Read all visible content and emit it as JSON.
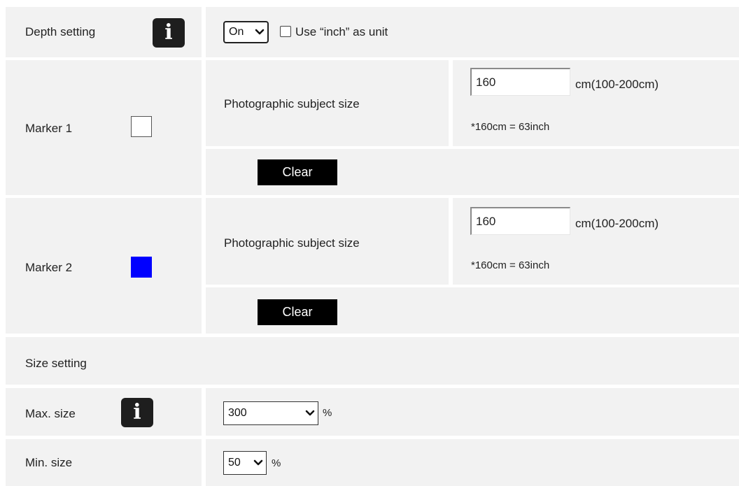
{
  "depth": {
    "label": "Depth setting",
    "info": "i",
    "select_value": "On",
    "inch_checkbox_label": "Use “inch” as unit"
  },
  "markers": [
    {
      "label": "Marker 1",
      "swatch_color": "#ffffff",
      "subject_label": "Photographic subject size",
      "size_value": "160",
      "unit_label": "cm(100-200cm)",
      "conversion_note": "*160cm = 63inch",
      "clear_label": "Clear"
    },
    {
      "label": "Marker 2",
      "swatch_color": "#0000ff",
      "subject_label": "Photographic subject size",
      "size_value": "160",
      "unit_label": "cm(100-200cm)",
      "conversion_note": "*160cm = 63inch",
      "clear_label": "Clear"
    }
  ],
  "size": {
    "section_label": "Size setting",
    "max_label": "Max. size",
    "max_info": "i",
    "max_value": "300",
    "max_unit": "%",
    "min_label": "Min. size",
    "min_value": "50",
    "min_unit": "%"
  }
}
